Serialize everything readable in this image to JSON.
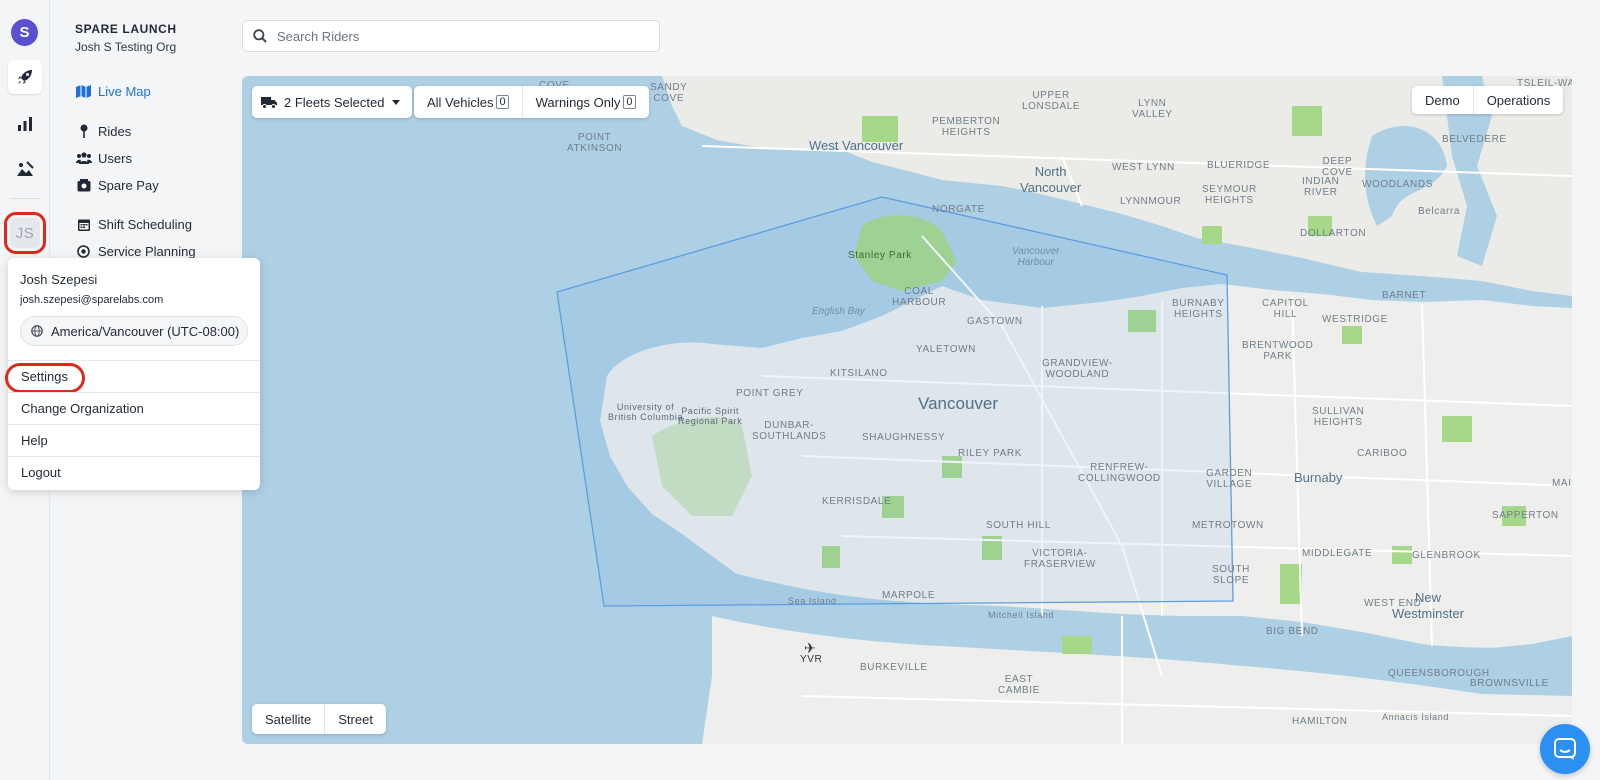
{
  "org": {
    "name": "SPARE LAUNCH",
    "subtitle": "Josh S Testing Org"
  },
  "rail": {
    "logo_letter": "S",
    "avatar_initials": "JS"
  },
  "nav": {
    "live_map": "Live Map",
    "rides": "Rides",
    "users": "Users",
    "spare_pay": "Spare Pay",
    "shift_scheduling": "Shift Scheduling",
    "service_planning": "Service Planning"
  },
  "search": {
    "placeholder": "Search Riders"
  },
  "map_controls": {
    "fleets_label": "2 Fleets Selected",
    "all_vehicles_label": "All Vehicles",
    "all_vehicles_count": "0",
    "warnings_label": "Warnings Only",
    "warnings_count": "0",
    "demo_label": "Demo",
    "operations_label": "Operations",
    "satellite_label": "Satellite",
    "street_label": "Street"
  },
  "map_labels": {
    "west_vancouver": "West Vancouver",
    "north_vancouver": "North\nVancouver",
    "vancouver": "Vancouver",
    "burnaby": "Burnaby",
    "new_westminster": "New\nWestminster",
    "english_bay": "English Bay",
    "vancouver_harbour": "Vancouver\nHarbour",
    "point_atkinson": "POINT\nATKINSON",
    "sandy_cove": "SANDY\nCOVE",
    "upper_lonsdale": "UPPER\nLONSDALE",
    "pemberton_heights": "PEMBERTON\nHEIGHTS",
    "lynn_valley": "LYNN\nVALLEY",
    "kitsilano": "KITSILANO",
    "point_grey": "POINT GREY",
    "dunbar": "DUNBAR-\nSOUTHLANDS",
    "shaughnessy": "SHAUGHNESSY",
    "kerrisdale": "KERRISDALE",
    "riley_park": "RILEY PARK",
    "south_hill": "SOUTH HILL",
    "marpole": "MARPOLE",
    "victoria_fraserview": "VICTORIA-\nFRASERVIEW",
    "renfrew": "RENFREW-\nCOLLINGWOOD",
    "grandview": "GRANDVIEW-\nWOODLAND",
    "yaletown": "YALETOWN",
    "gastown": "GASTOWN",
    "coal_harbour": "COAL\nHARBOUR",
    "stanley_park": "Stanley Park",
    "ubc": "University of\nBritish Columbia",
    "pacific_spirit": "Pacific Spirit\nRegional Park",
    "sea_island": "Sea Island",
    "mitchell_island": "Mitchell Island",
    "yvr": "YVR",
    "burkeville": "BURKEVILLE",
    "east_cambie": "EAST\nCAMBIE",
    "metrotown": "METROTOWN",
    "garden_village": "GARDEN\nVILLAGE",
    "south_slope": "SOUTH\nSLOPE",
    "middlegate": "MIDDLEGATE",
    "west_end": "WEST END",
    "big_bend": "BIG BEND",
    "glenbrook": "GLENBROOK",
    "sapperton": "SAPPERTON",
    "queensborough": "QUEENSBOROUGH",
    "brownsville": "BROWNSVILLE",
    "hamilton": "HAMILTON",
    "annacis": "Annacis Island",
    "capitol_hill": "CAPITOL\nHILL",
    "westridge": "WESTRIDGE",
    "brentwood": "BRENTWOOD\nPARK",
    "burnaby_heights": "BURNABY\nHEIGHTS",
    "sullivan": "SULLIVAN\nHEIGHTS",
    "cariboo": "CARIBOO",
    "barnet": "BARNET",
    "dollarton": "DOLLARTON",
    "belcarra": "Belcarra",
    "deep_cove": "DEEP\nCOVE",
    "indian_river": "INDIAN\nRIVER",
    "seymour": "SEYMOUR\nHEIGHTS",
    "blueridge": "BLUERIDGE",
    "lynnmour": "LYNNMOUR",
    "west_lynn": "WEST LYNN",
    "norgate": "NORGATE",
    "woodlands": "WOODLANDS",
    "belvedere": "BELVEDERE",
    "maillardville": "MAILL",
    "cove": "Cove",
    "tsleil": "Tsleil-Wa"
  },
  "user_menu": {
    "name": "Josh Szepesi",
    "email": "josh.szepesi@sparelabs.com",
    "timezone": "America/Vancouver (UTC-08:00)",
    "settings": "Settings",
    "change_org": "Change Organization",
    "help": "Help",
    "logout": "Logout"
  },
  "colors": {
    "accent": "#1f6fd6",
    "brand": "#5a4fcf",
    "highlight_ring": "#e0281c",
    "water": "#aed0e5",
    "land": "#eeefec",
    "park": "#a6d88a",
    "zone": "#5b9ee0",
    "chat": "#2c8ff2"
  }
}
